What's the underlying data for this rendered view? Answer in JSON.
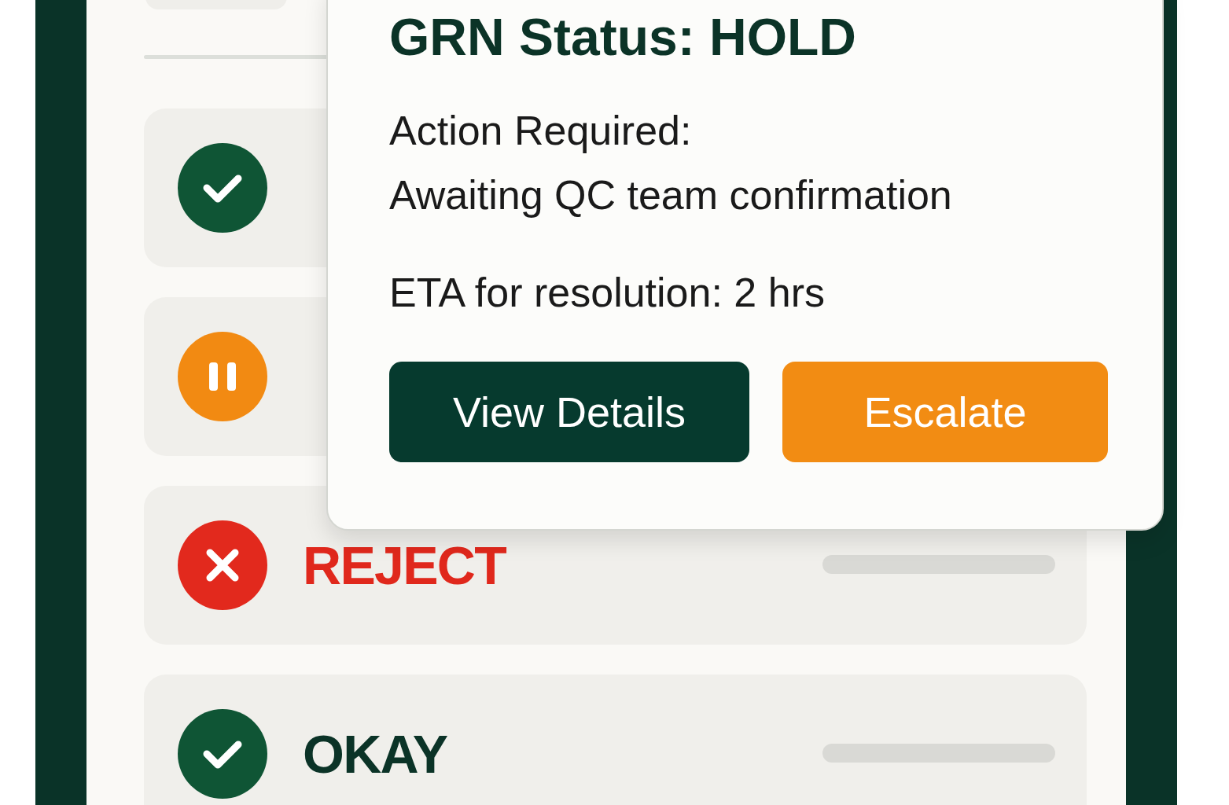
{
  "status_rows": [
    {
      "kind": "ok"
    },
    {
      "kind": "hold"
    },
    {
      "kind": "reject",
      "label": "REJECT"
    },
    {
      "kind": "ok",
      "label": "OKAY"
    }
  ],
  "popup": {
    "title": "GRN Status: HOLD",
    "action_label": "Action Required:",
    "action_text": "Awaiting QC team confirmation",
    "eta": "ETA for resolution: 2 hrs",
    "buttons": [
      {
        "kind": "primary",
        "label": "View Details"
      },
      {
        "kind": "accent",
        "label": "Escalate"
      }
    ]
  }
}
